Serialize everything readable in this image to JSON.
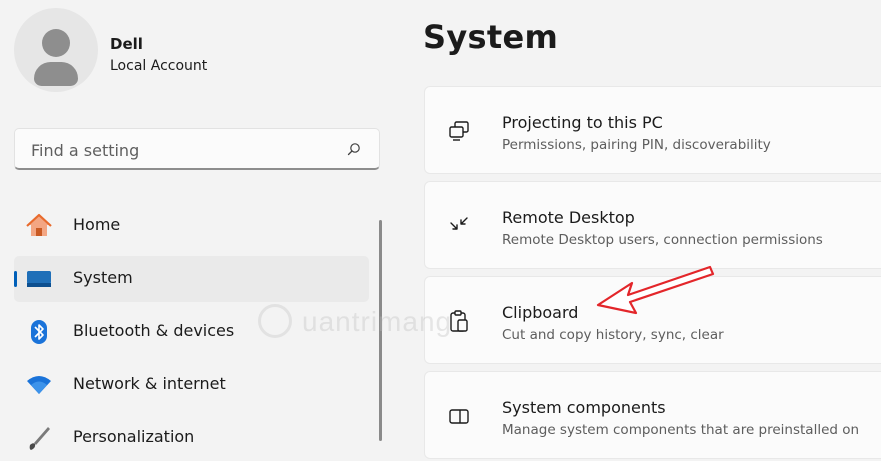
{
  "user": {
    "name": "Dell",
    "account_type": "Local Account"
  },
  "search": {
    "placeholder": "Find a setting",
    "icon": "search-icon"
  },
  "sidebar": {
    "items": [
      {
        "label": "Home",
        "icon": "home-icon",
        "selected": false
      },
      {
        "label": "System",
        "icon": "system-icon",
        "selected": true
      },
      {
        "label": "Bluetooth & devices",
        "icon": "bluetooth-icon",
        "selected": false
      },
      {
        "label": "Network & internet",
        "icon": "wifi-icon",
        "selected": false
      },
      {
        "label": "Personalization",
        "icon": "brush-icon",
        "selected": false
      }
    ]
  },
  "main": {
    "title": "System",
    "cards": [
      {
        "title": "Projecting to this PC",
        "subtitle": "Permissions, pairing PIN, discoverability",
        "icon": "projector-icon"
      },
      {
        "title": "Remote Desktop",
        "subtitle": "Remote Desktop users, connection permissions",
        "icon": "remote-desktop-icon"
      },
      {
        "title": "Clipboard",
        "subtitle": "Cut and copy history, sync, clear",
        "icon": "clipboard-icon"
      },
      {
        "title": "System components",
        "subtitle": "Manage system components that are preinstalled on",
        "icon": "system-components-icon"
      }
    ]
  },
  "watermark": {
    "text": "uantrimang"
  },
  "colors": {
    "accent": "#005fb8",
    "annotation": "#e3262a",
    "background": "#f3f3f3"
  }
}
